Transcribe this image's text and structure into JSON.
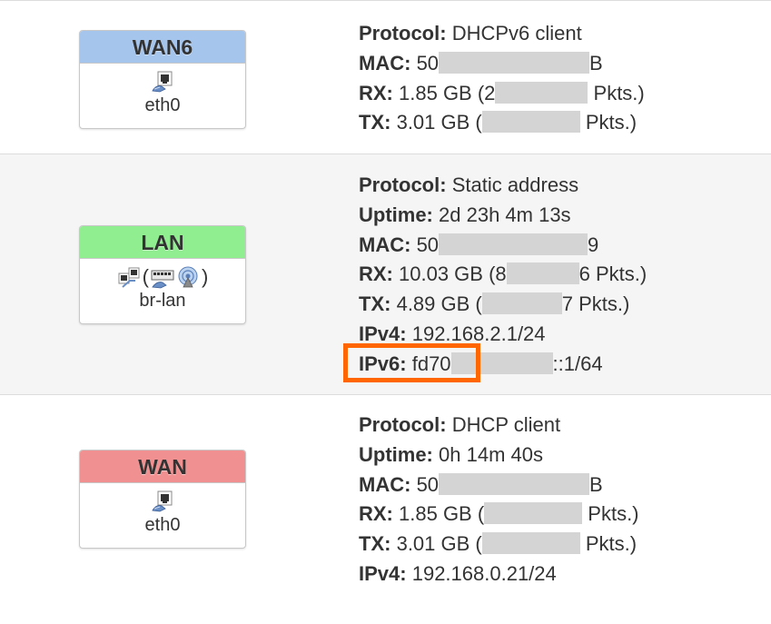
{
  "interfaces": [
    {
      "name": "WAN6",
      "color": "#a6c5ec",
      "device": "eth0",
      "icons": [
        "ethernet-port-icon"
      ],
      "info": [
        {
          "label": "Protocol:",
          "value": "DHCPv6 client"
        },
        {
          "label": "MAC:",
          "prefix": "50",
          "suffix": "B"
        },
        {
          "label": "RX:",
          "prefix": "1.85 GB (2",
          "suffix": " Pkts.)"
        },
        {
          "label": "TX:",
          "prefix": "3.01 GB (",
          "suffix": " Pkts.)"
        }
      ]
    },
    {
      "name": "LAN",
      "color": "#90ee90",
      "device": "br-lan",
      "icons": [
        "bridge-icon",
        "switch-icon",
        "wireless-icon"
      ],
      "paren_open": "(",
      "paren_close": ")",
      "info": [
        {
          "label": "Protocol:",
          "value": "Static address"
        },
        {
          "label": "Uptime:",
          "value": "2d 23h 4m 13s"
        },
        {
          "label": "MAC:",
          "prefix": "50",
          "suffix": "9"
        },
        {
          "label": "RX:",
          "prefix": "10.03 GB (8",
          "suffix": "6 Pkts.)"
        },
        {
          "label": "TX:",
          "prefix": "4.89 GB (",
          "suffix": "7 Pkts.)"
        },
        {
          "label": "IPv4:",
          "value": "192.168.2.1/24"
        },
        {
          "label": "IPv6:",
          "prefix": "fd70",
          "suffix": "::1/64"
        }
      ]
    },
    {
      "name": "WAN",
      "color": "#f09090",
      "device": "eth0",
      "icons": [
        "ethernet-port-icon"
      ],
      "info": [
        {
          "label": "Protocol:",
          "value": "DHCP client"
        },
        {
          "label": "Uptime:",
          "value": "0h 14m 40s"
        },
        {
          "label": "MAC:",
          "prefix": "50",
          "suffix": "B"
        },
        {
          "label": "RX:",
          "prefix": "1.85 GB (",
          "suffix": " Pkts.)"
        },
        {
          "label": "TX:",
          "prefix": "3.01 GB (",
          "suffix": " Pkts.)"
        },
        {
          "label": "IPv4:",
          "value": "192.168.0.21/24"
        }
      ]
    }
  ],
  "highlight_color": "#ff6600"
}
